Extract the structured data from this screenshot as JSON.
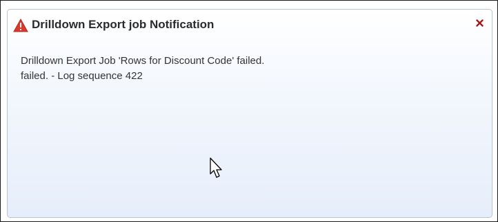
{
  "notification": {
    "title": "Drilldown Export job Notification",
    "close_label": "×",
    "message_lines": [
      "Drilldown Export Job 'Rows for Discount Code' failed.",
      "failed. - Log sequence 422"
    ],
    "icon": "warning-icon"
  },
  "colors": {
    "warning": "#d93a2b",
    "close": "#a11a1a",
    "border": "#b9c4d2"
  }
}
